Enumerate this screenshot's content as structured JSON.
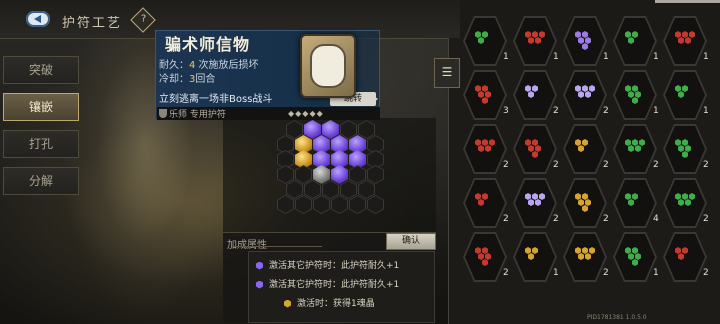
{
  "header": {
    "title": "护符工艺",
    "help_icon": "?"
  },
  "sidebar": {
    "tabs": [
      {
        "label": "突破",
        "active": false
      },
      {
        "label": "镶嵌",
        "active": true
      },
      {
        "label": "打孔",
        "active": false
      },
      {
        "label": "分解",
        "active": false
      }
    ]
  },
  "item": {
    "name": "骗术师信物",
    "durability_label": "耐久：",
    "durability_value": "4",
    "durability_suffix": " 次施放后损坏",
    "cooldown_label": "冷却：",
    "cooldown_value": "3",
    "cooldown_suffix": "回合",
    "description": "立刻逃离一场非Boss战斗",
    "jump_button": "跳转",
    "type": "乐师 专用护符"
  },
  "attributes": {
    "title": "加成属性",
    "confirm_button": "确认",
    "rows": [
      {
        "text": "激活其它护符时：此护符耐久+1",
        "color": "#8a66f0"
      },
      {
        "text": "激活其它护符时：此护符耐久+1",
        "color": "#8a66f0"
      },
      {
        "text": "激活时：获得1魂晶",
        "color": "#d6a531"
      }
    ]
  },
  "inventory": {
    "filter_icon": "filter-icon",
    "slots": [
      {
        "color": "#3fae4a",
        "count": "1"
      },
      {
        "color": "#c63a2e",
        "count": "1"
      },
      {
        "color": "#9a7be6",
        "count": "1"
      },
      {
        "color": "#3fae4a",
        "count": "1"
      },
      {
        "color": "#c63a2e",
        "count": "1"
      },
      {
        "color": "#c63a2e",
        "count": "3"
      },
      {
        "color": "#b9a6ee",
        "count": "2"
      },
      {
        "color": "#b9a6ee",
        "count": "2"
      },
      {
        "color": "#3fae4a",
        "count": "1"
      },
      {
        "color": "#3fae4a",
        "count": "1"
      },
      {
        "color": "#c63a2e",
        "count": "2"
      },
      {
        "color": "#c63a2e",
        "count": "2"
      },
      {
        "color": "#d6a531",
        "count": "2"
      },
      {
        "color": "#3fae4a",
        "count": "2"
      },
      {
        "color": "#3fae4a",
        "count": "2"
      },
      {
        "color": "#c63a2e",
        "count": "2"
      },
      {
        "color": "#b9a6ee",
        "count": "2"
      },
      {
        "color": "#d6a531",
        "count": "2"
      },
      {
        "color": "#3fae4a",
        "count": "4"
      },
      {
        "color": "#3fae4a",
        "count": "2"
      },
      {
        "color": "#c63a2e",
        "count": "2"
      },
      {
        "color": "#d6a531",
        "count": "1"
      },
      {
        "color": "#d6a531",
        "count": "2"
      },
      {
        "color": "#3fae4a",
        "count": "1"
      },
      {
        "color": "#c63a2e",
        "count": "2"
      }
    ]
  },
  "footer": {
    "version": "PID1781381 1.0.5.0"
  }
}
